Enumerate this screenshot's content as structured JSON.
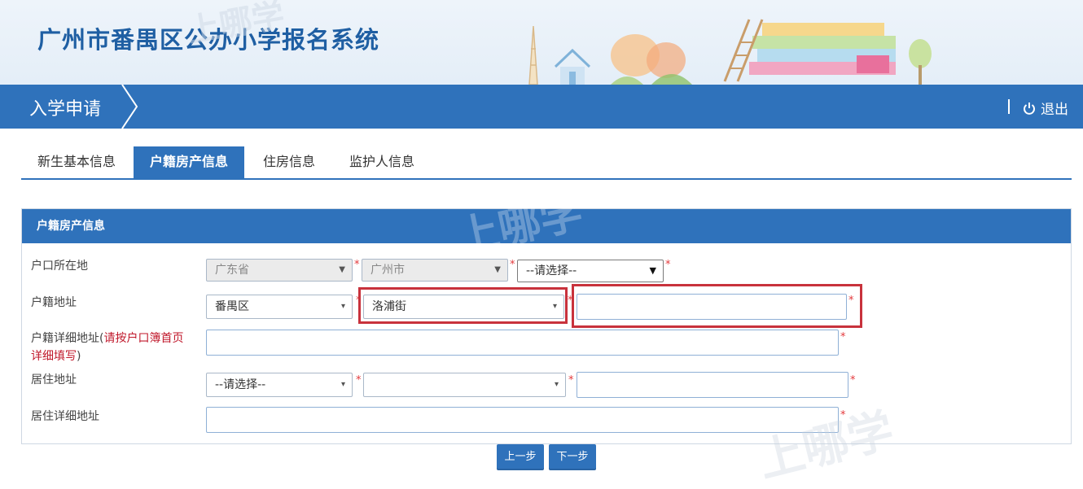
{
  "app": {
    "title": "广州市番禺区公办小学报名系统"
  },
  "navbar": {
    "title": "入学申请",
    "separator": "|",
    "logout_label": "退出"
  },
  "tabs": [
    {
      "label": "新生基本信息",
      "active": false
    },
    {
      "label": "户籍房产信息",
      "active": true
    },
    {
      "label": "住房信息",
      "active": false
    },
    {
      "label": "监护人信息",
      "active": false
    }
  ],
  "form": {
    "panel_title": "户籍房产信息",
    "required_mark": "*",
    "hukou_location": {
      "label": "户口所在地",
      "province": "广东省",
      "city": "广州市",
      "district": "--请选择--"
    },
    "hukou_address": {
      "label": "户籍地址",
      "district": "番禺区",
      "street": "洛浦街",
      "community": ""
    },
    "hukou_detail": {
      "label": "户籍详细地址(",
      "hint": "请按户口簿首页详细填写",
      "label_suffix": ")",
      "value": ""
    },
    "residence_address": {
      "label": "居住地址",
      "district": "--请选择--",
      "street": "",
      "community": ""
    },
    "residence_detail": {
      "label": "居住详细地址",
      "value": ""
    }
  },
  "buttons": {
    "prev": "上一步",
    "next": "下一步"
  },
  "watermark": {
    "text": "上哪学"
  },
  "colors": {
    "primary": "#2f72bb",
    "title": "#1f5fa3",
    "required": "#e4393c",
    "highlight": "#c8323c"
  },
  "icons": {
    "logout": "power-icon",
    "dropdown": "chevron-down-icon"
  }
}
